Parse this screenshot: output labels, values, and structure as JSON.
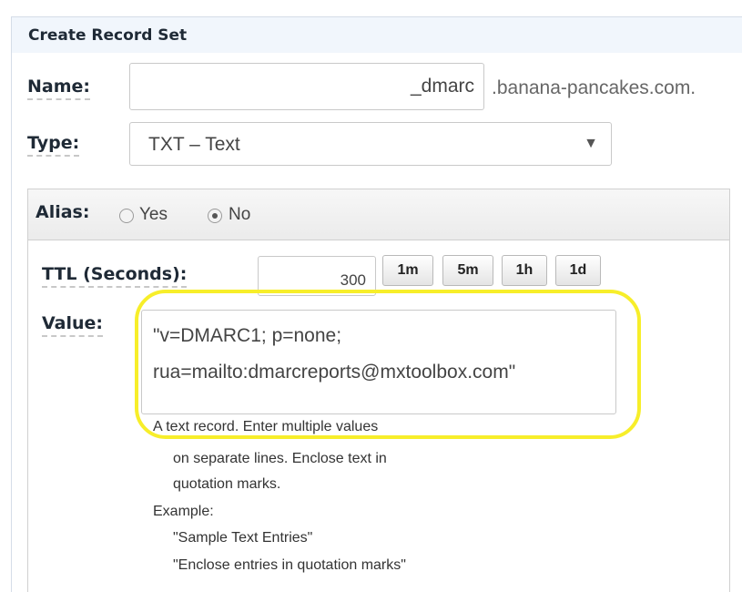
{
  "panel": {
    "title": "Create Record Set"
  },
  "name_field": {
    "label": "Name:",
    "value": "_dmarc",
    "suffix": ".banana-pancakes.com."
  },
  "type_field": {
    "label": "Type:",
    "selected": "TXT – Text"
  },
  "alias": {
    "label": "Alias:",
    "options": [
      {
        "label": "Yes",
        "checked": false
      },
      {
        "label": "No",
        "checked": true
      }
    ]
  },
  "ttl": {
    "label": "TTL (Seconds):",
    "value": "300",
    "presets": [
      "1m",
      "5m",
      "1h",
      "1d"
    ]
  },
  "value_field": {
    "label": "Value:",
    "lines": [
      "\"v=DMARC1; p=none;",
      "rua=mailto:dmarcreports@mxtoolbox.com\""
    ]
  },
  "help": {
    "lines": [
      "A text record. Enter multiple values",
      "on separate lines. Enclose text in",
      "quotation marks.",
      "Example:",
      "\"Sample Text Entries\"",
      "\"Enclose entries in quotation marks\""
    ]
  },
  "colors": {
    "highlight": "#f7ee2a",
    "header_bg": "#f1f6fc"
  }
}
